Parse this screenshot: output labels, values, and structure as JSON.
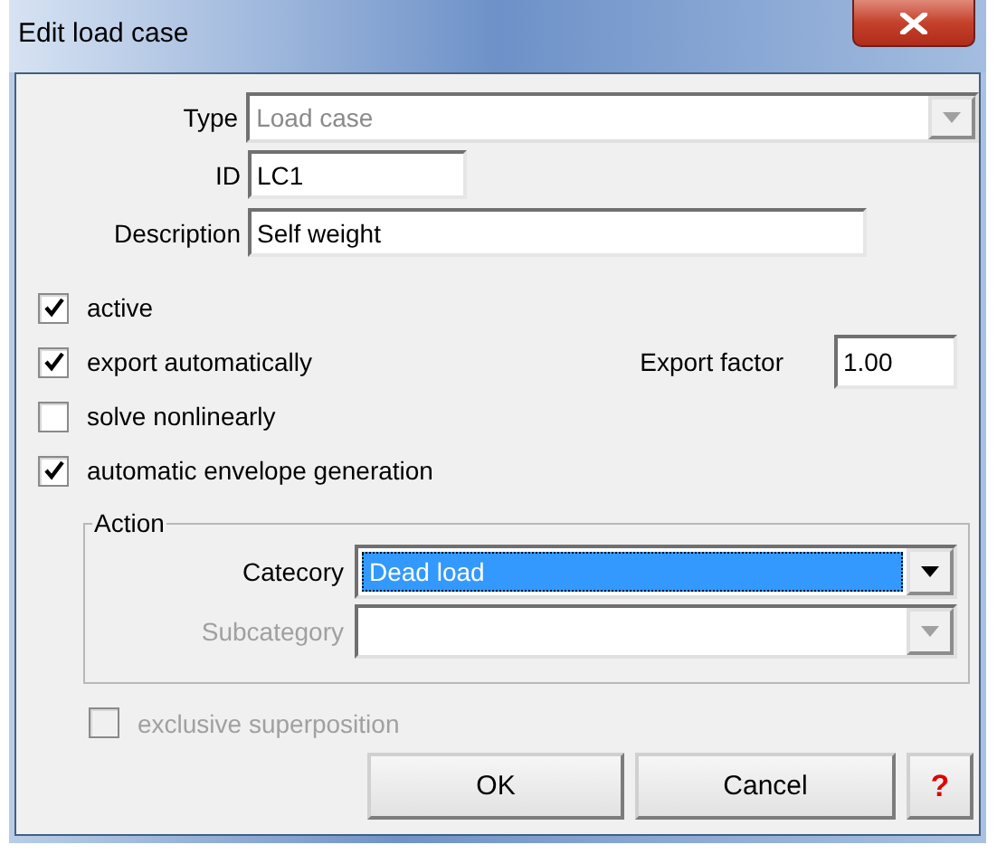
{
  "window": {
    "title": "Edit load case"
  },
  "type": {
    "label": "Type",
    "value": "Load case",
    "disabled": true
  },
  "id": {
    "label": "ID",
    "value": "LC1"
  },
  "description": {
    "label": "Description",
    "value": "Self weight"
  },
  "options": [
    {
      "label": "active",
      "checked": true
    },
    {
      "label": "export automatically",
      "checked": true
    },
    {
      "label": "solve nonlinearly",
      "checked": false
    },
    {
      "label": "automatic envelope generation",
      "checked": true
    }
  ],
  "export_factor": {
    "label": "Export factor",
    "value": "1.00"
  },
  "action": {
    "title": "Action",
    "category": {
      "label": "Catecory",
      "value": "Dead load",
      "disabled": false,
      "focused": true
    },
    "subcategory": {
      "label": "Subcategory",
      "disabled": true
    }
  },
  "exclusive": {
    "label": "exclusive superposition",
    "checked": false,
    "disabled": true
  },
  "buttons": [
    {
      "label": "OK"
    },
    {
      "label": "Cancel"
    }
  ],
  "help": "?"
}
